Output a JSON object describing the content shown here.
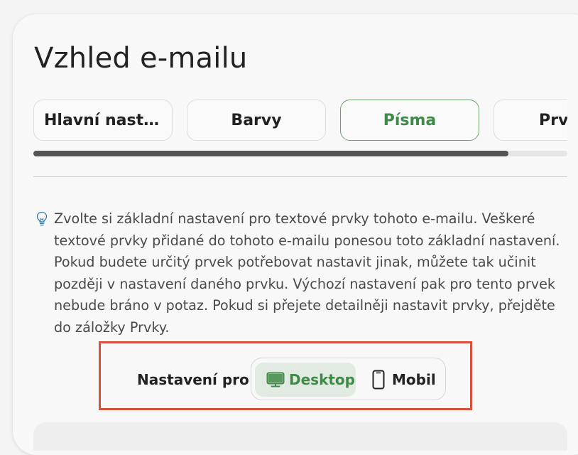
{
  "page": {
    "title": "Vzhled e-mailu"
  },
  "tabs": [
    {
      "label": "Hlavní nastavení",
      "active": false
    },
    {
      "label": "Barvy",
      "active": false
    },
    {
      "label": "Písma",
      "active": true
    },
    {
      "label": "Prvky",
      "active": false
    }
  ],
  "tabs_scroll": {
    "visible_fraction": 0.89
  },
  "info": {
    "icon": "lightbulb-icon",
    "text": "Zvolte si základní nastavení pro textové prvky tohoto e-mailu. Veškeré textové prvky přidané do tohoto e-mailu ponesou toto základní nastavení. Pokud budete určitý prvek potřebovat nastavit jinak, můžete tak učinit později v nastavení daného prvku. Výchozí nastavení pak pro tento prvek nebude bráno v potaz. Pokud si přejete detailněji nastavit prvky, přejděte do záložky Prvky."
  },
  "settings_for": {
    "label": "Nastavení pro",
    "options": [
      {
        "label": "Desktop",
        "icon": "monitor-icon",
        "selected": true
      },
      {
        "label": "Mobil",
        "icon": "phone-icon",
        "selected": false
      }
    ]
  },
  "colors": {
    "accent_green": "#3f8a48",
    "selected_bg": "#e1ebe1",
    "highlight_red": "#d9503c"
  }
}
